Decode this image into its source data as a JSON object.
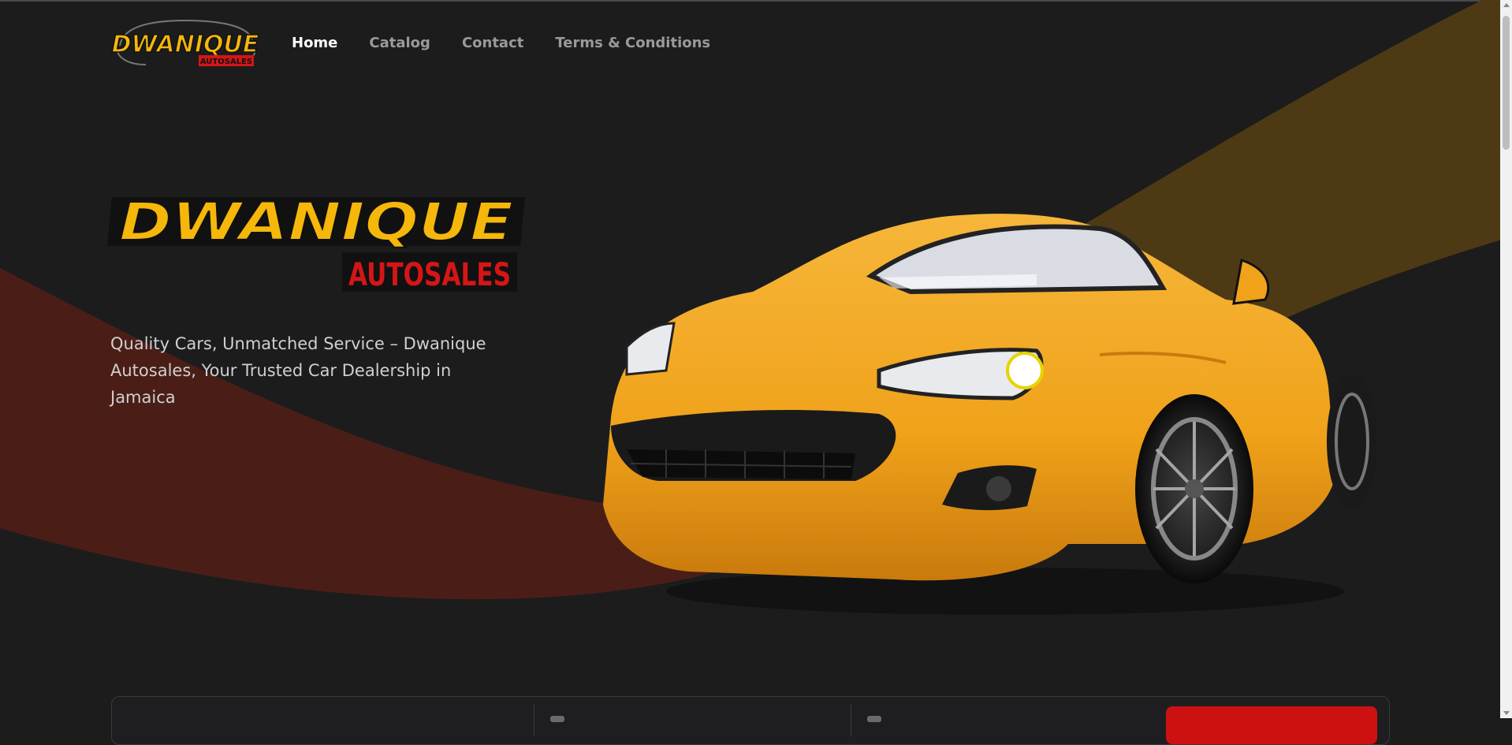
{
  "brand": {
    "name": "DWANIQUE",
    "sub": "AUTOSALES",
    "logo_colors": {
      "yellow": "#f5b70a",
      "red": "#d41616",
      "outline": "#111111"
    }
  },
  "nav": {
    "items": [
      {
        "label": "Home",
        "active": true
      },
      {
        "label": "Catalog",
        "active": false
      },
      {
        "label": "Contact",
        "active": false
      },
      {
        "label": "Terms & Conditions",
        "active": false
      }
    ]
  },
  "hero": {
    "tagline": "Quality Cars, Unmatched Service – Dwanique Autosales, Your Trusted Car Dealership in Jamaica"
  },
  "colors": {
    "background": "#1c1c1d",
    "swoosh_red": "#4a1e17",
    "swoosh_gold": "#4d3a14",
    "car_body": "#f0a21a",
    "accent_red": "#cc1111"
  }
}
